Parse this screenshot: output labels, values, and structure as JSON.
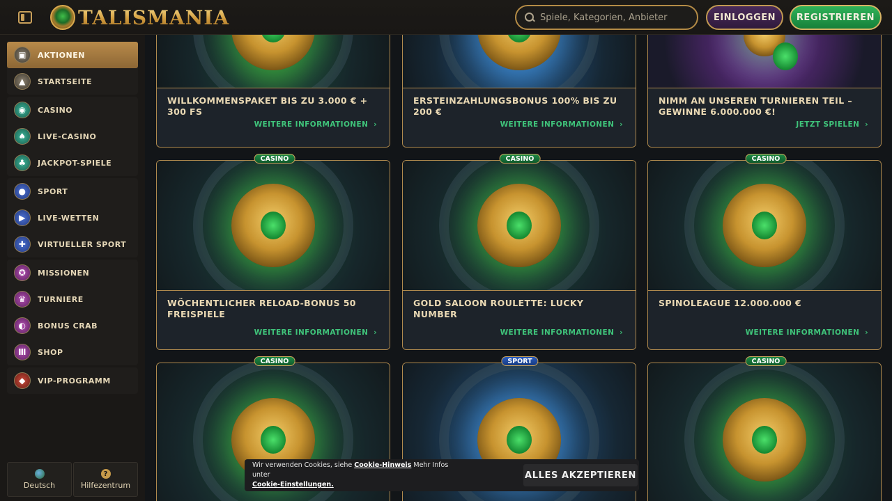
{
  "header": {
    "logo_text": "TALISMANIA",
    "search_placeholder": "Spiele, Kategorien, Anbieter",
    "login_label": "EINLOGGEN",
    "register_label": "REGISTRIEREN"
  },
  "sidebar": {
    "items": [
      {
        "label": "AKTIONEN",
        "icon": "gift-box-icon"
      },
      {
        "label": "STARTSEITE",
        "icon": "pyramid-icon"
      },
      {
        "label": "CASINO",
        "icon": "casino-chip-icon"
      },
      {
        "label": "LIVE-CASINO",
        "icon": "spade-icon"
      },
      {
        "label": "JACKPOT-SPIELE",
        "icon": "clover-icon"
      },
      {
        "label": "SPORT",
        "icon": "soccer-ball-icon"
      },
      {
        "label": "LIVE-WETTEN",
        "icon": "play-screen-icon"
      },
      {
        "label": "VIRTUELLER SPORT",
        "icon": "gamepad-icon"
      },
      {
        "label": "MISSIONEN",
        "icon": "medal-icon"
      },
      {
        "label": "TURNIERE",
        "icon": "trophy-icon"
      },
      {
        "label": "BONUS CRAB",
        "icon": "crab-claw-icon"
      },
      {
        "label": "SHOP",
        "icon": "temple-icon"
      },
      {
        "label": "VIP-PROGRAMM",
        "icon": "diamond-icon"
      }
    ],
    "footer": {
      "language_label": "Deutsch",
      "help_label": "Hilfezentrum"
    }
  },
  "cards": [
    {
      "title": "WILLKOMMENSPAKET BIS ZU 3.000 € + 300 FS",
      "link": "WEITERE INFORMATIONEN",
      "badge": ""
    },
    {
      "title": "ERSTEINZAHLUNGSBONUS 100% BIS ZU 200 €",
      "link": "WEITERE INFORMATIONEN",
      "badge": ""
    },
    {
      "title": "NIMM AN UNSEREN TURNIEREN TEIL – GEWINNE 6.000.000 €!",
      "link": "JETZT SPIELEN",
      "badge": ""
    },
    {
      "title": "WÖCHENTLICHER RELOAD-BONUS 50 FREISPIELE",
      "link": "WEITERE INFORMATIONEN",
      "badge": "CASINO"
    },
    {
      "title": "GOLD SALOON ROULETTE: LUCKY NUMBER",
      "link": "WEITERE INFORMATIONEN",
      "badge": "CASINO"
    },
    {
      "title": "SPINOLEAGUE 12.000.000 €",
      "link": "WEITERE INFORMATIONEN",
      "badge": "CASINO"
    },
    {
      "title": "",
      "link": "",
      "badge": "CASINO"
    },
    {
      "title": "",
      "link": "",
      "badge": "SPORT"
    },
    {
      "title": "",
      "link": "",
      "badge": "CASINO"
    }
  ],
  "cookie": {
    "text_before": "Wir verwenden Cookies, siehe",
    "link1": "Cookie-Hinweis",
    "text_middle": "Mehr Infos unter",
    "link2": "Cookie-Einstellungen.",
    "accept_label": "ALLES AKZEPTIEREN"
  },
  "colors": {
    "accent_gold": "#b08a4e",
    "link_green": "#3fc37a",
    "register_green": "#1f9a48",
    "login_purple": "#3d2449"
  }
}
